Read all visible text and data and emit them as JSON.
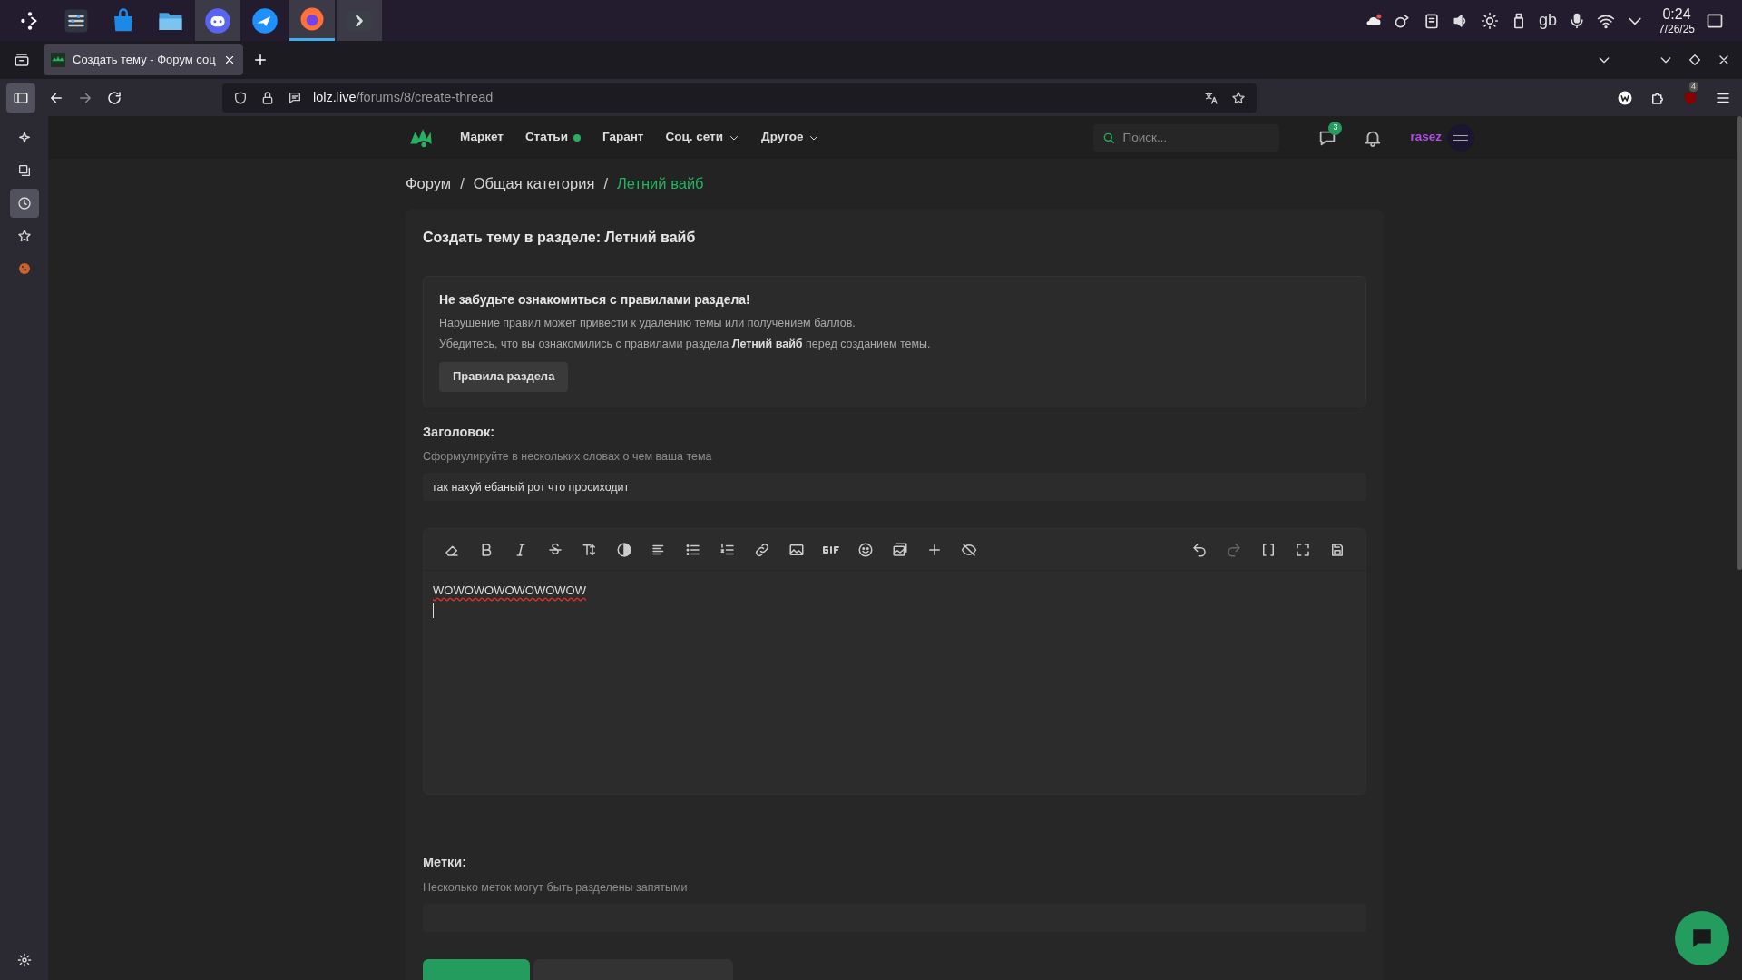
{
  "taskbar": {
    "apps": [
      {
        "running": false,
        "selected": false
      },
      {
        "running": false,
        "selected": false
      },
      {
        "running": false,
        "selected": false
      },
      {
        "running": true,
        "selected": false
      },
      {
        "running": false,
        "selected": false
      },
      {
        "running": true,
        "selected": true
      },
      {
        "running": true,
        "selected": false
      }
    ],
    "tray_text": "gb",
    "time": "0:24",
    "date": "7/26/25"
  },
  "browser": {
    "tab_title": "Создать тему - Форум соц",
    "url_host": "lolz.live",
    "url_path": "/forums/8/create-thread",
    "extension_badge": "4",
    "sidebar": [
      {
        "selected": false
      },
      {
        "selected": false
      },
      {
        "selected": true
      },
      {
        "selected": false
      },
      {
        "selected": false
      }
    ]
  },
  "site": {
    "nav": [
      {
        "label": "Маркет",
        "kind": "link"
      },
      {
        "label": "Статьи",
        "kind": "dot"
      },
      {
        "label": "Гарант",
        "kind": "link"
      },
      {
        "label": "Соц. сети",
        "kind": "menu"
      },
      {
        "label": "Другое",
        "kind": "menu"
      }
    ],
    "search": {
      "placeholder": "Поиск..."
    },
    "messages_badge": "3",
    "username": "rasez"
  },
  "breadcrumb_separators": [
    "/",
    "/"
  ],
  "breadcrumbs": [
    {
      "label": "Форум",
      "selected": false
    },
    {
      "label": "Общая категория",
      "selected": false
    },
    {
      "label": "Летний вайб",
      "selected": true
    }
  ],
  "form": {
    "title": "Создать тему в разделе: Летний вайб",
    "notice": {
      "heading": "Не забудьте ознакомиться с правилами раздела!",
      "lines": [
        "Нарушение правил может привести к удалению темы или получением баллов.",
        "Убедитесь, что вы ознакомились с правилами раздела **Летний вайб** перед созданием темы."
      ],
      "button": "Правила раздела"
    },
    "thread_title": {
      "label": "Заголовок:",
      "hint": "Сформулируйте в нескольких словах о чем ваша тема",
      "value": "так нахуй ебаный рот что просиходит"
    },
    "editor": {
      "text": "WOWOWOWOWOWOWOW"
    },
    "tags": {
      "label": "Метки:",
      "hint": "Несколько меток могут быть разделены запятыми"
    }
  }
}
